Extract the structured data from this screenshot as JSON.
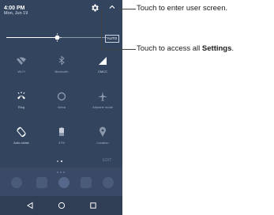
{
  "status": {
    "time": "4:00 PM",
    "date": "Mon, Jun 19"
  },
  "brightness": {
    "level": 0.5,
    "auto_label": "AUTO"
  },
  "tiles": [
    {
      "label": "Wi-Fi",
      "icon": "wifi-off-icon",
      "active": false
    },
    {
      "label": "Bluetooth",
      "icon": "bluetooth-icon",
      "active": false
    },
    {
      "label": "CMCC",
      "icon": "cellular-signal-icon",
      "active": true
    },
    {
      "label": "Ring",
      "icon": "ring-icon",
      "active": true
    },
    {
      "label": "Alexa",
      "icon": "alexa-icon",
      "active": false
    },
    {
      "label": "Airplane mode",
      "icon": "airplane-icon",
      "active": false
    },
    {
      "label": "Auto-rotate",
      "icon": "auto-rotate-icon",
      "active": true
    },
    {
      "label": "37%",
      "icon": "battery-icon",
      "active": false
    },
    {
      "label": "Location",
      "icon": "location-icon",
      "active": false
    }
  ],
  "pager": {
    "edit_label": "EDIT"
  },
  "callouts": {
    "user_screen": "Touch to enter user screen.",
    "settings_prefix": "Touch to access all ",
    "settings_bold": "Settings",
    "settings_suffix": "."
  },
  "colors": {
    "shade": "#33445e",
    "accent_white": "#ffffff",
    "inactive": "#8b97ab"
  }
}
